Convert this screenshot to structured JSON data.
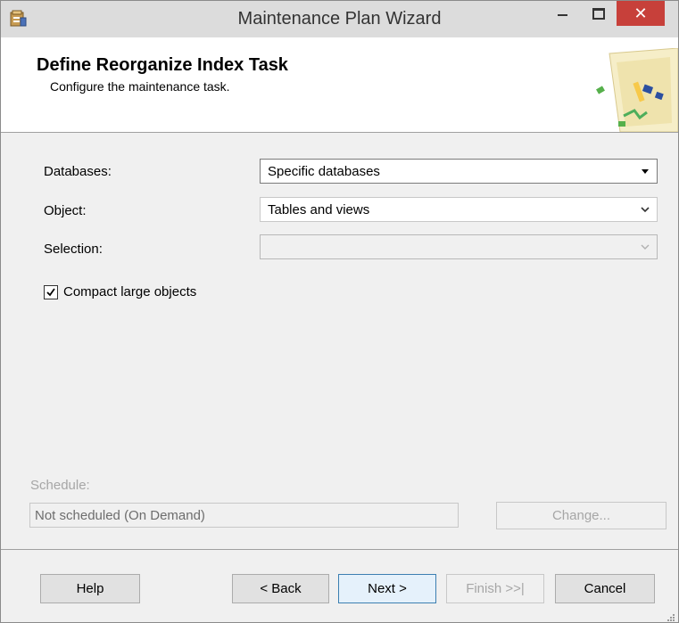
{
  "window": {
    "title": "Maintenance Plan Wizard",
    "close_glyph": "✕"
  },
  "header": {
    "title": "Define Reorganize Index Task",
    "subtitle": "Configure the maintenance task."
  },
  "form": {
    "databases": {
      "label": "Databases:",
      "value": "Specific databases"
    },
    "object": {
      "label": "Object:",
      "value": "Tables and views"
    },
    "selection": {
      "label": "Selection:",
      "value": ""
    },
    "compact": {
      "label": "Compact large objects",
      "checked": true
    }
  },
  "schedule": {
    "label": "Schedule:",
    "value": "Not scheduled (On Demand)",
    "change_label": "Change..."
  },
  "buttons": {
    "help": "Help",
    "back": "< Back",
    "next": "Next >",
    "finish": "Finish >>|",
    "cancel": "Cancel"
  },
  "icons": {
    "app": "maintenance-plan-icon",
    "header": "maintenance-task-graphic-icon"
  }
}
